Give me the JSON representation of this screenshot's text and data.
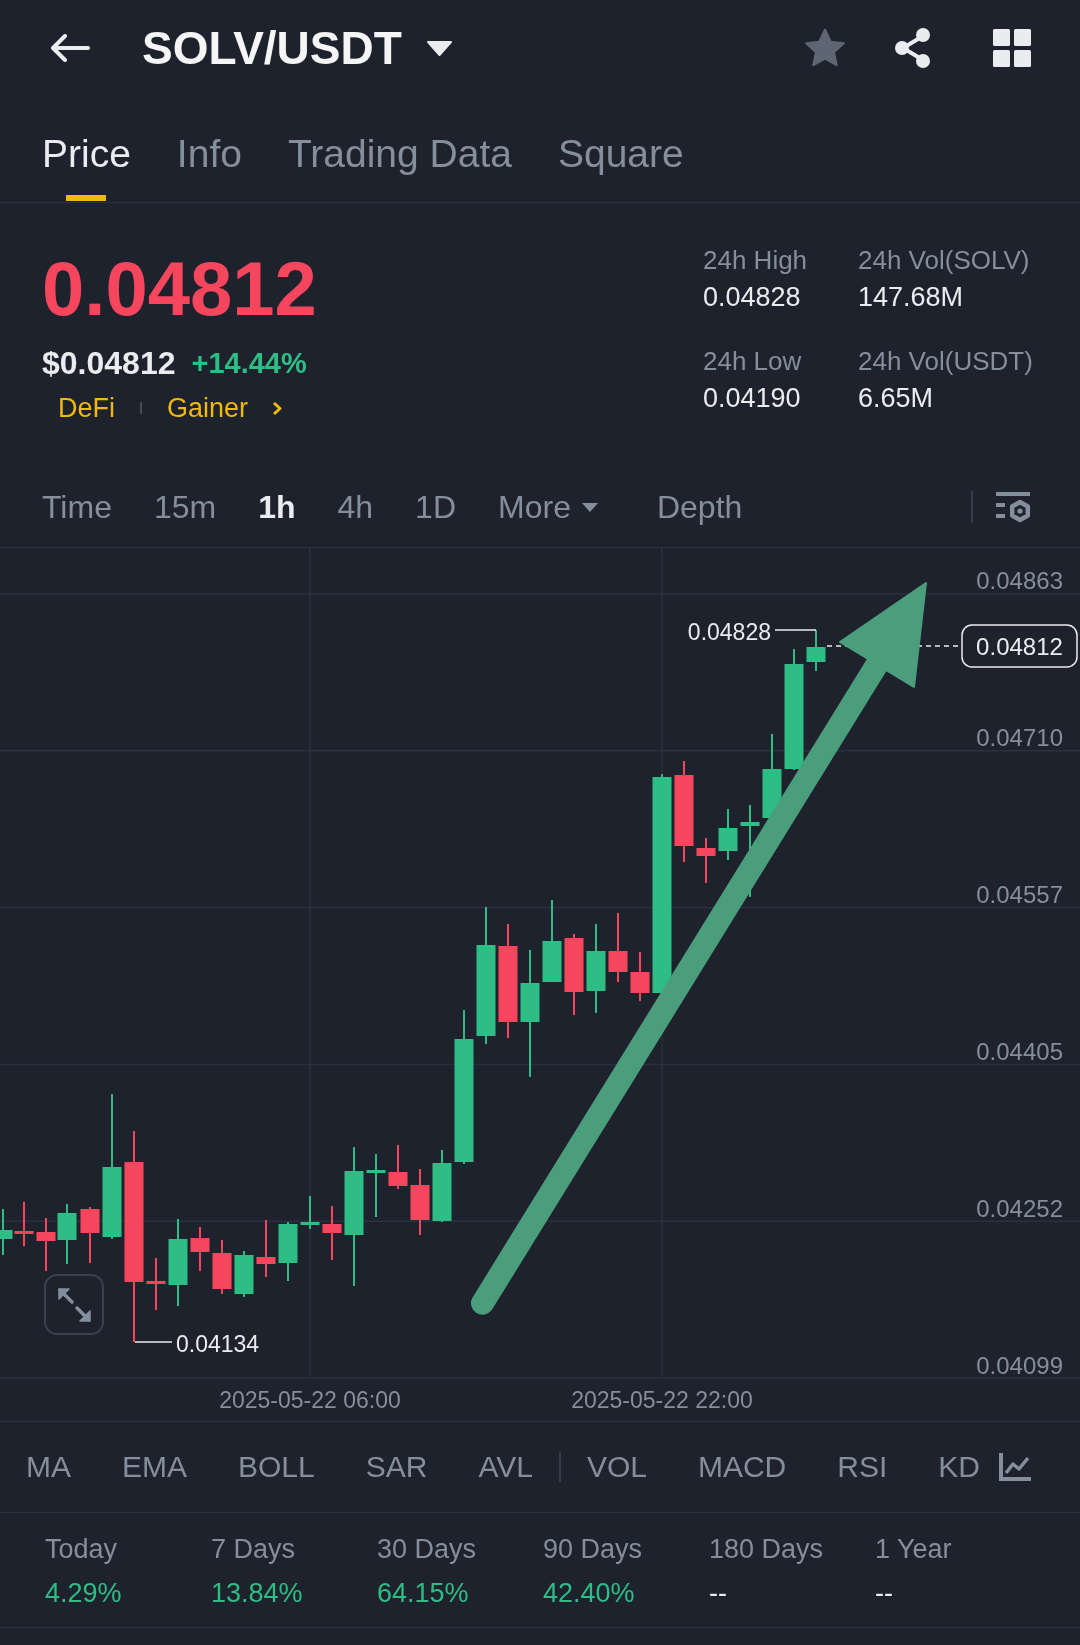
{
  "header": {
    "title": "SOLV/USDT",
    "favorited": false
  },
  "tabs": [
    {
      "label": "Price",
      "selected": true
    },
    {
      "label": "Info",
      "selected": false
    },
    {
      "label": "Trading Data",
      "selected": false
    },
    {
      "label": "Square",
      "selected": false
    }
  ],
  "ticker": {
    "last_price": "0.04812",
    "usd_price": "$0.04812",
    "change": "+14.44%",
    "tags": [
      "DeFi",
      "Gainer"
    ]
  },
  "stats": [
    {
      "label": "24h High",
      "value": "0.04828"
    },
    {
      "label": "24h Vol(SOLV)",
      "value": "147.68M"
    },
    {
      "label": "24h Low",
      "value": "0.04190"
    },
    {
      "label": "24h Vol(USDT)",
      "value": "6.65M"
    }
  ],
  "intervals": [
    {
      "label": "Time",
      "kind": "interval",
      "selected": false
    },
    {
      "label": "15m",
      "kind": "interval",
      "selected": false
    },
    {
      "label": "1h",
      "kind": "interval",
      "selected": true
    },
    {
      "label": "4h",
      "kind": "interval",
      "selected": false
    },
    {
      "label": "1D",
      "kind": "interval",
      "selected": false
    },
    {
      "label": "More",
      "kind": "menu",
      "selected": false
    },
    {
      "label": "Depth",
      "kind": "view",
      "selected": false
    }
  ],
  "chart": {
    "price_axis": [
      "0.04863",
      "0.04710",
      "0.04557",
      "0.04405",
      "0.04252",
      "0.04099"
    ],
    "time_axis": [
      "2025-05-22 06:00",
      "2025-05-22 22:00"
    ],
    "high_marker": "0.04828",
    "low_marker": "0.04134",
    "current_price": "0.04812"
  },
  "indicators": {
    "main": [
      "MA",
      "EMA",
      "BOLL",
      "SAR",
      "AVL"
    ],
    "sub": [
      "VOL",
      "MACD",
      "RSI",
      "KD"
    ]
  },
  "performance": [
    {
      "label": "Today",
      "value": "4.29%",
      "kind": "gain"
    },
    {
      "label": "7 Days",
      "value": "13.84%",
      "kind": "gain"
    },
    {
      "label": "30 Days",
      "value": "64.15%",
      "kind": "gain"
    },
    {
      "label": "90 Days",
      "value": "42.40%",
      "kind": "gain"
    },
    {
      "label": "180 Days",
      "value": "--",
      "kind": "empty"
    },
    {
      "label": "1 Year",
      "value": "--",
      "kind": "empty"
    }
  ]
}
